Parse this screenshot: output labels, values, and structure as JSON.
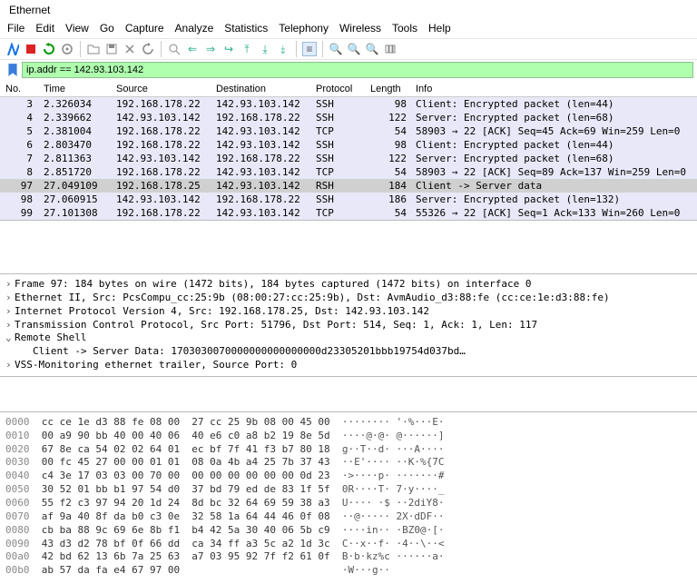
{
  "window": {
    "title": "Ethernet"
  },
  "menu": [
    "File",
    "Edit",
    "View",
    "Go",
    "Capture",
    "Analyze",
    "Statistics",
    "Telephony",
    "Wireless",
    "Tools",
    "Help"
  ],
  "filter": {
    "value": "ip.addr == 142.93.103.142"
  },
  "columns": [
    "No.",
    "Time",
    "Source",
    "Destination",
    "Protocol",
    "Length",
    "Info"
  ],
  "packets": [
    {
      "no": "3",
      "time": "2.326034",
      "src": "192.168.178.22",
      "dst": "142.93.103.142",
      "proto": "SSH",
      "len": "98",
      "info": "Client: Encrypted packet (len=44)",
      "cls": "shade"
    },
    {
      "no": "4",
      "time": "2.339662",
      "src": "142.93.103.142",
      "dst": "192.168.178.22",
      "proto": "SSH",
      "len": "122",
      "info": "Server: Encrypted packet (len=68)",
      "cls": "shade"
    },
    {
      "no": "5",
      "time": "2.381004",
      "src": "192.168.178.22",
      "dst": "142.93.103.142",
      "proto": "TCP",
      "len": "54",
      "info": "58903 → 22 [ACK] Seq=45 Ack=69 Win=259 Len=0",
      "cls": "shade"
    },
    {
      "no": "6",
      "time": "2.803470",
      "src": "192.168.178.22",
      "dst": "142.93.103.142",
      "proto": "SSH",
      "len": "98",
      "info": "Client: Encrypted packet (len=44)",
      "cls": "shade"
    },
    {
      "no": "7",
      "time": "2.811363",
      "src": "142.93.103.142",
      "dst": "192.168.178.22",
      "proto": "SSH",
      "len": "122",
      "info": "Server: Encrypted packet (len=68)",
      "cls": "shade"
    },
    {
      "no": "8",
      "time": "2.851720",
      "src": "192.168.178.22",
      "dst": "142.93.103.142",
      "proto": "TCP",
      "len": "54",
      "info": "58903 → 22 [ACK] Seq=89 Ack=137 Win=259 Len=0",
      "cls": "shade"
    },
    {
      "no": "97",
      "time": "27.049109",
      "src": "192.168.178.25",
      "dst": "142.93.103.142",
      "proto": "RSH",
      "len": "184",
      "info": "Client -> Server data",
      "cls": "rsh selected"
    },
    {
      "no": "98",
      "time": "27.060915",
      "src": "142.93.103.142",
      "dst": "192.168.178.22",
      "proto": "SSH",
      "len": "186",
      "info": "Server: Encrypted packet (len=132)",
      "cls": "shade"
    },
    {
      "no": "99",
      "time": "27.101308",
      "src": "192.168.178.22",
      "dst": "142.93.103.142",
      "proto": "TCP",
      "len": "54",
      "info": "55326 → 22 [ACK] Seq=1 Ack=133 Win=260 Len=0",
      "cls": "shade"
    }
  ],
  "tree": [
    {
      "t": ">",
      "text": "Frame 97: 184 bytes on wire (1472 bits), 184 bytes captured (1472 bits) on interface 0"
    },
    {
      "t": ">",
      "text": "Ethernet II, Src: PcsCompu_cc:25:9b (08:00:27:cc:25:9b), Dst: AvmAudio_d3:88:fe (cc:ce:1e:d3:88:fe)"
    },
    {
      "t": ">",
      "text": "Internet Protocol Version 4, Src: 192.168.178.25, Dst: 142.93.103.142"
    },
    {
      "t": ">",
      "text": "Transmission Control Protocol, Src Port: 51796, Dst Port: 514, Seq: 1, Ack: 1, Len: 117"
    },
    {
      "t": "v",
      "text": "Remote Shell"
    },
    {
      "t": " ",
      "text": "Client -> Server Data: 1703030070000000000000000d23305201bbb19754d037bd…",
      "indent": true
    },
    {
      "t": ">",
      "text": "VSS-Monitoring ethernet trailer, Source Port: 0"
    }
  ],
  "hex": [
    {
      "off": "0000",
      "b": "cc ce 1e d3 88 fe 08 00  27 cc 25 9b 08 00 45 00",
      "a": "········ '·%···E·"
    },
    {
      "off": "0010",
      "b": "00 a9 90 bb 40 00 40 06  40 e6 c0 a8 b2 19 8e 5d",
      "a": "····@·@· @······]"
    },
    {
      "off": "0020",
      "b": "67 8e ca 54 02 02 64 01  ec bf 7f 41 f3 b7 80 18",
      "a": "g··T··d· ···A····"
    },
    {
      "off": "0030",
      "b": "00 fc 45 27 00 00 01 01  08 0a 4b a4 25 7b 37 43",
      "a": "··E'···· ··K·%{7C"
    },
    {
      "off": "0040",
      "b": "c4 3e 17 03 03 00 70 00  00 00 00 00 00 00 0d 23",
      "a": "·>····p· ·······#"
    },
    {
      "off": "0050",
      "b": "30 52 01 bb b1 97 54 d0  37 bd 79 ed de 83 1f 5f",
      "a": "0R····T· 7·y····_"
    },
    {
      "off": "0060",
      "b": "55 f2 c3 97 94 20 1d 24  8d bc 32 64 69 59 38 a3",
      "a": "U···· ·$ ··2diY8·"
    },
    {
      "off": "0070",
      "b": "af 9a 40 8f da b0 c3 0e  32 58 1a 64 44 46 0f 08",
      "a": "··@····· 2X·dDF··"
    },
    {
      "off": "0080",
      "b": "cb ba 88 9c 69 6e 8b f1  b4 42 5a 30 40 06 5b c9",
      "a": "····in·· ·BZ0@·[·"
    },
    {
      "off": "0090",
      "b": "43 d3 d2 78 bf 0f 66 dd  ca 34 ff a3 5c a2 1d 3c",
      "a": "C··x··f· ·4··\\··<"
    },
    {
      "off": "00a0",
      "b": "42 bd 62 13 6b 7a 25 63  a7 03 95 92 7f f2 61 0f",
      "a": "B·b·kz%c ······a·"
    },
    {
      "off": "00b0",
      "b": "ab 57 da fa e4 67 97 00",
      "a": "·W···g··"
    }
  ]
}
